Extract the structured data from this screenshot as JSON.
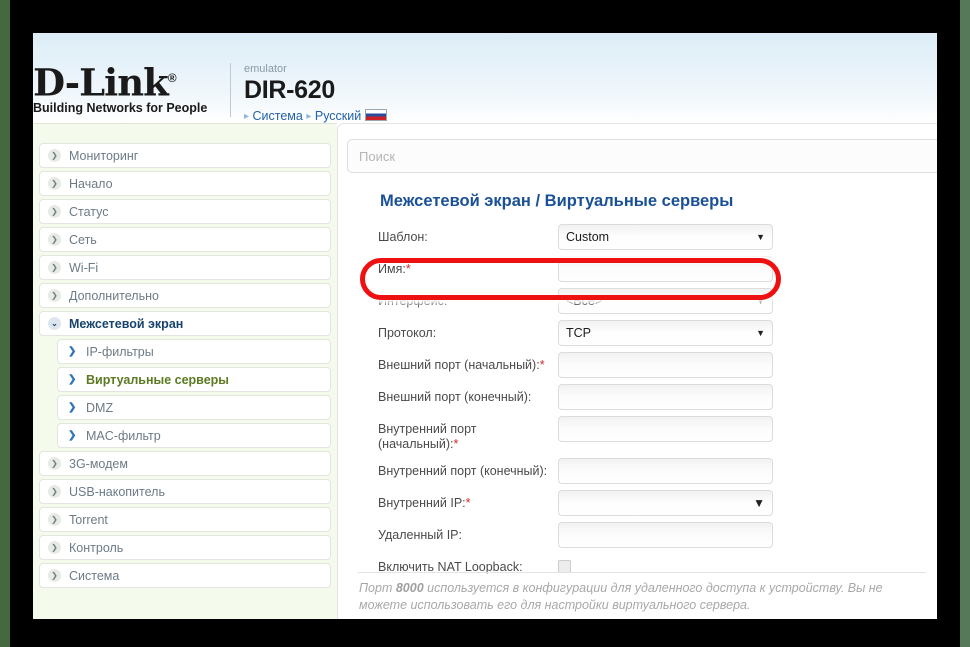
{
  "brand": {
    "wordmark": "D-Link",
    "registered": "®",
    "tagline": "Building Networks for People"
  },
  "header": {
    "emulator_label": "emulator",
    "model": "DIR-620",
    "crumb_arrow": "▸",
    "crumbs": [
      "Система",
      "Русский"
    ],
    "flag_name": "russian-flag"
  },
  "search": {
    "value": "",
    "placeholder": "Поиск"
  },
  "sidebar": {
    "items": [
      {
        "label": "Мониторинг",
        "icon": "circle-chevron-right-icon",
        "level": 0,
        "state": "normal"
      },
      {
        "label": "Начало",
        "icon": "circle-chevron-right-icon",
        "level": 0,
        "state": "normal"
      },
      {
        "label": "Статус",
        "icon": "circle-chevron-right-icon",
        "level": 0,
        "state": "normal"
      },
      {
        "label": "Сеть",
        "icon": "circle-chevron-right-icon",
        "level": 0,
        "state": "normal"
      },
      {
        "label": "Wi-Fi",
        "icon": "circle-chevron-right-icon",
        "level": 0,
        "state": "normal"
      },
      {
        "label": "Дополнительно",
        "icon": "circle-chevron-right-icon",
        "level": 0,
        "state": "normal"
      },
      {
        "label": "Межсетевой экран",
        "icon": "circle-chevron-down-icon",
        "level": 0,
        "state": "expanded"
      },
      {
        "label": "IP-фильтры",
        "icon": "chevron-right-icon",
        "level": 1,
        "state": "normal"
      },
      {
        "label": "Виртуальные серверы",
        "icon": "chevron-right-icon",
        "level": 1,
        "state": "selected"
      },
      {
        "label": "DMZ",
        "icon": "chevron-right-icon",
        "level": 1,
        "state": "normal"
      },
      {
        "label": "MAC-фильтр",
        "icon": "chevron-right-icon",
        "level": 1,
        "state": "normal"
      },
      {
        "label": "3G-модем",
        "icon": "circle-chevron-right-icon",
        "level": 0,
        "state": "normal"
      },
      {
        "label": "USB-накопитель",
        "icon": "circle-chevron-right-icon",
        "level": 0,
        "state": "normal"
      },
      {
        "label": "Torrent",
        "icon": "circle-chevron-right-icon",
        "level": 0,
        "state": "normal"
      },
      {
        "label": "Контроль",
        "icon": "circle-chevron-right-icon",
        "level": 0,
        "state": "normal"
      },
      {
        "label": "Система",
        "icon": "circle-chevron-right-icon",
        "level": 0,
        "state": "normal"
      }
    ],
    "icon_glyphs": {
      "circle-chevron-right-icon": "❯",
      "circle-chevron-down-icon": "⌄",
      "chevron-right-icon": "❯"
    }
  },
  "main": {
    "title": "Межсетевой экран /  Виртуальные серверы",
    "form": [
      {
        "label": "Шаблон:",
        "required": false,
        "type": "select",
        "value": "Custom",
        "name": "template-select"
      },
      {
        "label": "Имя:",
        "required": true,
        "type": "text",
        "value": "",
        "name": "name-input"
      },
      {
        "label": "Интерфейс:",
        "required": false,
        "type": "select",
        "value": "<Все>",
        "name": "interface-select"
      },
      {
        "label": "Протокол:",
        "required": false,
        "type": "select",
        "value": "TCP",
        "name": "protocol-select"
      },
      {
        "label": "Внешний порт (начальный):",
        "required": true,
        "type": "text",
        "value": "",
        "name": "external-port-start-input"
      },
      {
        "label": "Внешний порт (конечный):",
        "required": false,
        "type": "text",
        "value": "",
        "name": "external-port-end-input"
      },
      {
        "label": "Внутренний порт (начальный):",
        "required": true,
        "type": "text",
        "value": "",
        "name": "internal-port-start-input"
      },
      {
        "label": "Внутренний порт (конечный):",
        "required": false,
        "type": "text",
        "value": "",
        "name": "internal-port-end-input"
      },
      {
        "label": "Внутренний IP:",
        "required": true,
        "type": "select",
        "value": "",
        "name": "internal-ip-select"
      },
      {
        "label": "Удаленный IP:",
        "required": false,
        "type": "text",
        "value": "",
        "name": "remote-ip-input"
      },
      {
        "label": "Включить NAT Loopback:",
        "required": false,
        "type": "checkbox",
        "value": "",
        "name": "nat-loopback-checkbox"
      }
    ],
    "note_prefix": "Порт ",
    "note_bold": "8000",
    "note_rest": " используется в конфигурации для удаленного доступа к устройству. Вы не можете использовать его для настройки виртуального сервера."
  },
  "annotation": {
    "name": "red-highlight-template-row",
    "color": "#ee1111"
  },
  "required_marker": "*"
}
